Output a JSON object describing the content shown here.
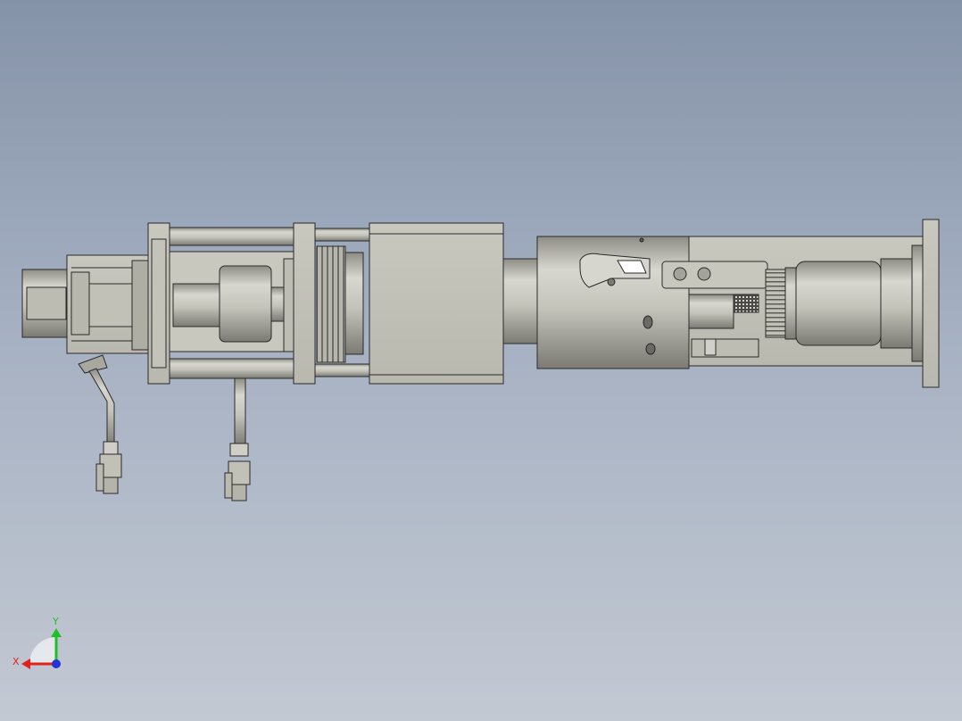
{
  "viewport": {
    "background_top": "#8593a8",
    "background_bottom": "#c3c9d3"
  },
  "model": {
    "icon": "actuator-assembly-icon",
    "body_color": "#c7c6bc",
    "shadow_color": "#8e8d85",
    "edge_color": "#2a2a2a"
  },
  "triad": {
    "x_label": "X",
    "y_label": "Y",
    "x_color": "#e0241b",
    "y_color": "#1fbf2a",
    "z_color": "#2433d6"
  }
}
